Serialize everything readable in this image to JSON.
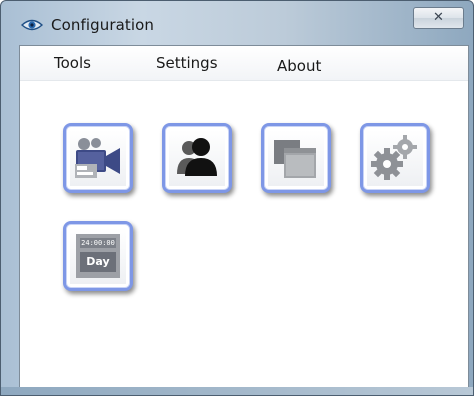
{
  "window": {
    "title": "Configuration",
    "close_label": "✕"
  },
  "menu": {
    "items": [
      {
        "label": "Tools"
      },
      {
        "label": "Settings"
      },
      {
        "label": "About"
      }
    ]
  },
  "tiles": [
    {
      "icon": "video-camera-icon"
    },
    {
      "icon": "users-icon"
    },
    {
      "icon": "windows-icon"
    },
    {
      "icon": "gears-icon"
    },
    {
      "icon": "day-schedule-icon",
      "time_text": "24:00:00",
      "day_text": "Day"
    }
  ]
}
